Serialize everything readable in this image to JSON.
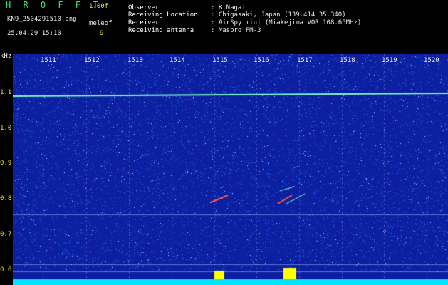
{
  "header": {
    "brand": "H R O F F T",
    "version": "1.00f",
    "filename": "KN9_2504291510.png",
    "datetime": "25.04.29 15:10",
    "meleof_label": "meleof",
    "meleof_value": "9"
  },
  "info": [
    {
      "label": "Observer",
      "value": ": K.Nagai"
    },
    {
      "label": "Receiving Location",
      "value": ": Chigasaki, Japan (139.414 35.340)"
    },
    {
      "label": "Receiver",
      "value": ": AirSpy mini (Miakejima VOR 108.65MHz)"
    },
    {
      "label": "Receiving antenna",
      "value": ": Maspro FM-3"
    }
  ],
  "y_unit": "kHz",
  "y_ticks": [
    "1.1",
    "1.0",
    "0.9",
    "0.8",
    "0.7",
    "0.6"
  ],
  "x_ticks": [
    "1511",
    "1512",
    "1513",
    "1514",
    "1515",
    "1516",
    "1517",
    "1518",
    "1519",
    "1520"
  ],
  "colors": {
    "background": "#0c1fa0",
    "noise": "#2a6cff",
    "carrier": "#7affc8",
    "meteor": "#ff5a40",
    "baseline": "#00e5ff",
    "burst": "#ffff00"
  }
}
